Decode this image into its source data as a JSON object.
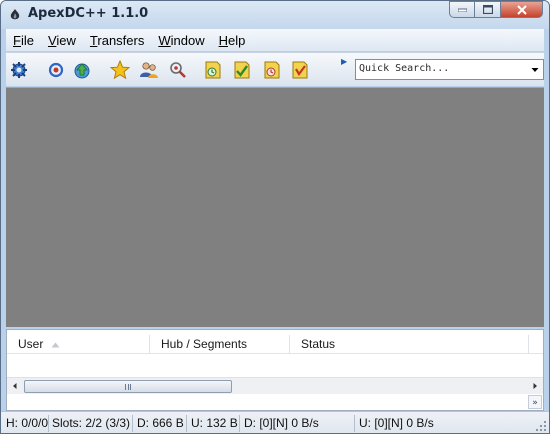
{
  "window": {
    "title": "ApexDC++ 1.1.0"
  },
  "menubar": {
    "items": [
      {
        "label_u": "F",
        "label_rest": "ile"
      },
      {
        "label_u": "V",
        "label_rest": "iew"
      },
      {
        "label_u": "T",
        "label_rest": "ransfers"
      },
      {
        "label_u": "W",
        "label_rest": "indow"
      },
      {
        "label_u": "H",
        "label_rest": "elp"
      }
    ]
  },
  "toolbar": {
    "icons": [
      "connect-icon",
      "reconnect-icon",
      "follow-redirect-icon",
      "favorites-icon",
      "users-icon",
      "search-spy-icon",
      "finished-downloads-icon",
      "finished-uploads-icon",
      "queue-icon",
      "notepad-icon"
    ],
    "quick_search": {
      "placeholder": "Quick Search..."
    }
  },
  "transfers": {
    "columns": [
      "User",
      "Hub / Segments",
      "Status"
    ]
  },
  "statusbar": {
    "cells": [
      "H: 0/0/0",
      "Slots: 2/2 (3/3)",
      "D: 666 B",
      "U: 132 B",
      "D: [0][N] 0 B/s",
      "U: [0][N] 0 B/s"
    ]
  },
  "colors": {
    "mdi_background": "#808080",
    "accent": "#1e5bb4"
  }
}
